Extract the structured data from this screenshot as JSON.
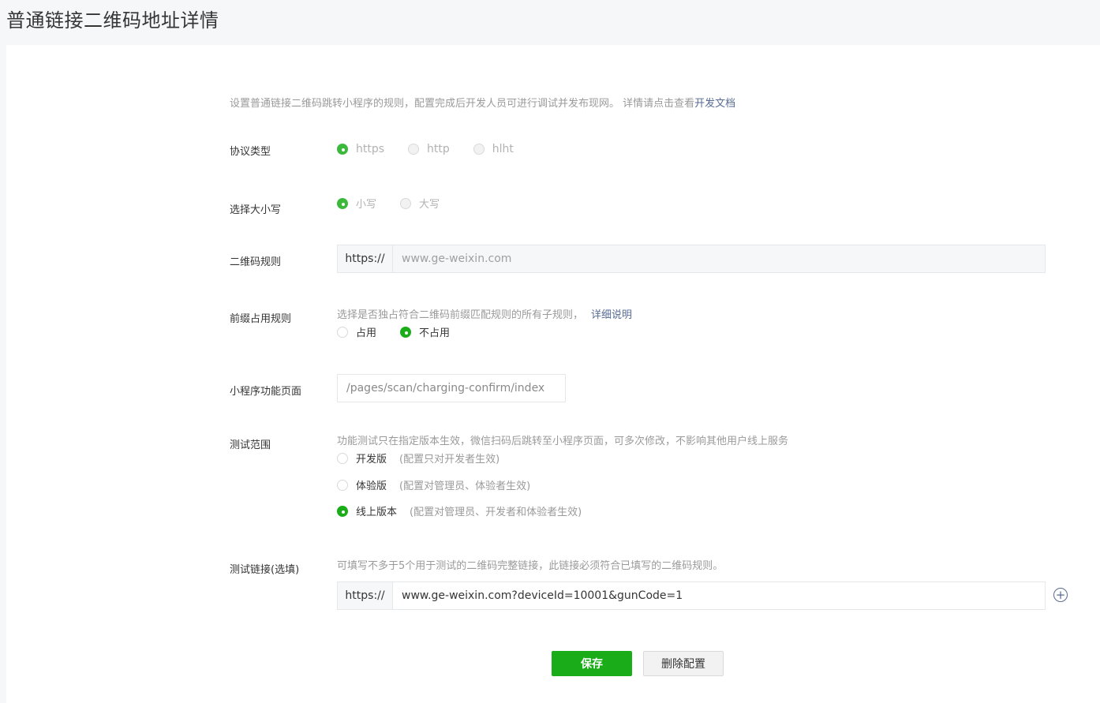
{
  "page": {
    "title": "普通链接二维码地址详情"
  },
  "intro": {
    "text": "设置普通链接二维码跳转小程序的规则，配置完成后开发人员可进行调试并发布现网。 详情请点击查看",
    "link": "开发文档"
  },
  "protocol": {
    "label": "协议类型",
    "options": [
      {
        "label": "https",
        "selected": true
      },
      {
        "label": "http",
        "selected": false
      },
      {
        "label": "hlht",
        "selected": false
      }
    ]
  },
  "case": {
    "label": "选择大小写",
    "options": [
      {
        "label": "小写",
        "selected": true
      },
      {
        "label": "大写",
        "selected": false
      }
    ]
  },
  "qr_rule": {
    "label": "二维码规则",
    "prefix": "https://",
    "value": "www.ge-weixin.com"
  },
  "prefix_rule": {
    "label": "前缀占用规则",
    "hint": "选择是否独占符合二维码前缀匹配规则的所有子规则，",
    "hint_link": "详细说明",
    "options": [
      {
        "label": "占用",
        "selected": false
      },
      {
        "label": "不占用",
        "selected": true
      }
    ]
  },
  "page_path": {
    "label": "小程序功能页面",
    "value": "/pages/scan/charging-confirm/index"
  },
  "test_scope": {
    "label": "测试范围",
    "hint": "功能测试只在指定版本生效，微信扫码后跳转至小程序页面，可多次修改，不影响其他用户线上服务",
    "options": [
      {
        "label": "开发版",
        "note": "(配置只对开发者生效)",
        "selected": false
      },
      {
        "label": "体验版",
        "note": "(配置对管理员、体验者生效)",
        "selected": false
      },
      {
        "label": "线上版本",
        "note": "(配置对管理员、开发者和体验者生效)",
        "selected": true
      }
    ]
  },
  "test_link": {
    "label": "测试链接(选填)",
    "hint": "可填写不多于5个用于测试的二维码完整链接，此链接必须符合已填写的二维码规则。",
    "prefix": "https://",
    "value": "www.ge-weixin.com?deviceId=10001&gunCode=1",
    "add_icon": "plus-circle-icon"
  },
  "actions": {
    "save": "保存",
    "delete": "删除配置"
  },
  "colors": {
    "accent": "#1aad19",
    "link": "#576b95"
  }
}
